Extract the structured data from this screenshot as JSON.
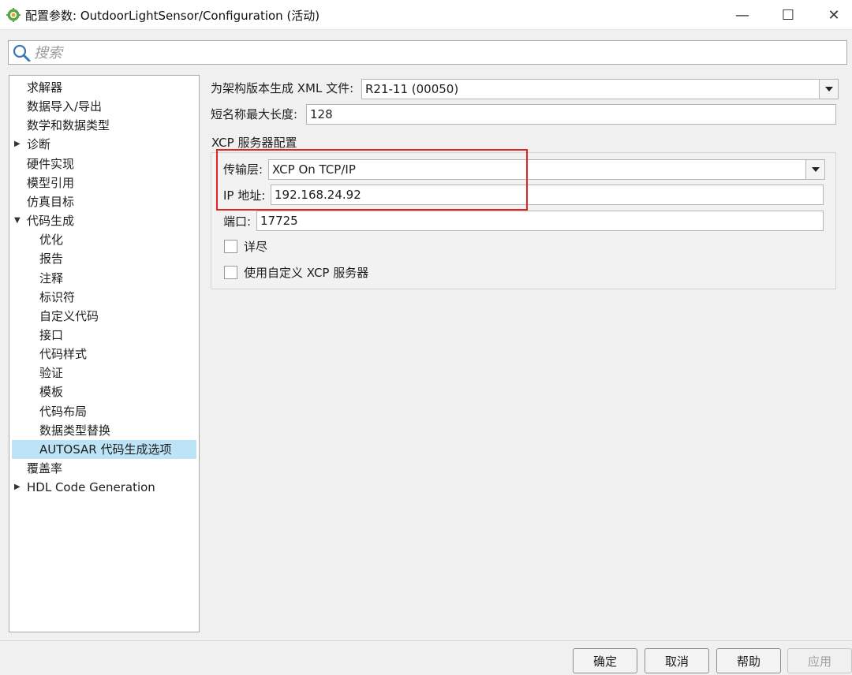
{
  "window": {
    "title": "配置参数: OutdoorLightSensor/Configuration (活动)",
    "icon": "matlab-config-icon",
    "minimize_glyph": "—",
    "maximize_glyph": "☐",
    "close_glyph": "✕"
  },
  "search": {
    "placeholder": "搜索",
    "value": ""
  },
  "tree": {
    "items": [
      {
        "label": "求解器",
        "level": 0,
        "expandable": false,
        "expanded": false,
        "selected": false
      },
      {
        "label": "数据导入/导出",
        "level": 0,
        "expandable": false,
        "expanded": false,
        "selected": false
      },
      {
        "label": "数学和数据类型",
        "level": 0,
        "expandable": false,
        "expanded": false,
        "selected": false
      },
      {
        "label": "诊断",
        "level": 0,
        "expandable": true,
        "expanded": false,
        "selected": false
      },
      {
        "label": "硬件实现",
        "level": 0,
        "expandable": false,
        "expanded": false,
        "selected": false
      },
      {
        "label": "模型引用",
        "level": 0,
        "expandable": false,
        "expanded": false,
        "selected": false
      },
      {
        "label": "仿真目标",
        "level": 0,
        "expandable": false,
        "expanded": false,
        "selected": false
      },
      {
        "label": "代码生成",
        "level": 0,
        "expandable": true,
        "expanded": true,
        "selected": false
      },
      {
        "label": "优化",
        "level": 1,
        "expandable": false,
        "expanded": false,
        "selected": false
      },
      {
        "label": "报告",
        "level": 1,
        "expandable": false,
        "expanded": false,
        "selected": false
      },
      {
        "label": "注释",
        "level": 1,
        "expandable": false,
        "expanded": false,
        "selected": false
      },
      {
        "label": "标识符",
        "level": 1,
        "expandable": false,
        "expanded": false,
        "selected": false
      },
      {
        "label": "自定义代码",
        "level": 1,
        "expandable": false,
        "expanded": false,
        "selected": false
      },
      {
        "label": "接口",
        "level": 1,
        "expandable": false,
        "expanded": false,
        "selected": false
      },
      {
        "label": "代码样式",
        "level": 1,
        "expandable": false,
        "expanded": false,
        "selected": false
      },
      {
        "label": "验证",
        "level": 1,
        "expandable": false,
        "expanded": false,
        "selected": false
      },
      {
        "label": "模板",
        "level": 1,
        "expandable": false,
        "expanded": false,
        "selected": false
      },
      {
        "label": "代码布局",
        "level": 1,
        "expandable": false,
        "expanded": false,
        "selected": false
      },
      {
        "label": "数据类型替换",
        "level": 1,
        "expandable": false,
        "expanded": false,
        "selected": false
      },
      {
        "label": "AUTOSAR 代码生成选项",
        "level": 1,
        "expandable": false,
        "expanded": false,
        "selected": true
      },
      {
        "label": "覆盖率",
        "level": 0,
        "expandable": false,
        "expanded": false,
        "selected": false
      },
      {
        "label": "HDL Code Generation",
        "level": 0,
        "expandable": true,
        "expanded": false,
        "selected": false
      }
    ]
  },
  "content": {
    "xml_version": {
      "label": "为架构版本生成 XML 文件:",
      "value": "R21-11 (00050)"
    },
    "short_name_len": {
      "label": "短名称最大长度:",
      "value": "128"
    },
    "xcp_group": {
      "title": "XCP 服务器配置",
      "transport": {
        "label": "传输层:",
        "value": "XCP On TCP/IP"
      },
      "ip": {
        "label": "IP 地址:",
        "value": "192.168.24.92"
      },
      "port": {
        "label": "端口:",
        "value": "17725"
      },
      "verbose": {
        "label": "详尽",
        "checked": false
      },
      "custom_server": {
        "label": "使用自定义 XCP 服务器",
        "checked": false
      }
    },
    "highlight_color": "#e02424"
  },
  "buttons": {
    "ok": "确定",
    "cancel": "取消",
    "help": "帮助",
    "apply": "应用",
    "apply_enabled": false
  }
}
